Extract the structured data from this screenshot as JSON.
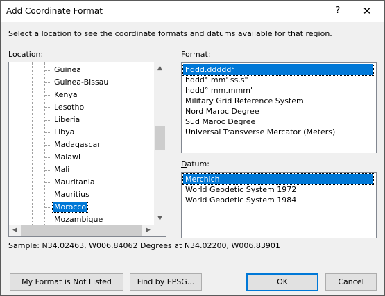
{
  "window": {
    "title": "Add Coordinate Format",
    "help_glyph": "?",
    "close_glyph": "✕"
  },
  "instructions": "Select a location to see the coordinate formats and datums available for that region.",
  "location": {
    "label_prefix": "",
    "label_accel": "L",
    "label_rest": "ocation:",
    "items": [
      "Guinea",
      "Guinea-Bissau",
      "Kenya",
      "Lesotho",
      "Liberia",
      "Libya",
      "Madagascar",
      "Malawi",
      "Mali",
      "Mauritania",
      "Mauritius",
      "Morocco",
      "Mozambique"
    ],
    "selected": "Morocco"
  },
  "format": {
    "label_accel": "F",
    "label_rest": "ormat:",
    "items": [
      "hddd.ddddd°",
      "hddd° mm' ss.s\"",
      "hddd° mm.mmm'",
      "Military Grid Reference System",
      "Nord Maroc Degree",
      "Sud Maroc Degree",
      "Universal Transverse Mercator (Meters)"
    ],
    "selected": "hddd.ddddd°"
  },
  "datum": {
    "label_accel": "D",
    "label_rest": "atum:",
    "items": [
      "Merchich",
      "World Geodetic System 1972",
      "World Geodetic System 1984"
    ],
    "selected": "Merchich"
  },
  "sample": "Sample: N34.02463, W006.84062 Degrees at N34.02200, W006.83901",
  "buttons": {
    "not_listed": "My Format is Not Listed",
    "find_epsg": "Find by EPSG...",
    "ok": "OK",
    "cancel": "Cancel"
  },
  "colors": {
    "selection": "#0078d7",
    "dialog_bg": "#f0f0f0"
  }
}
